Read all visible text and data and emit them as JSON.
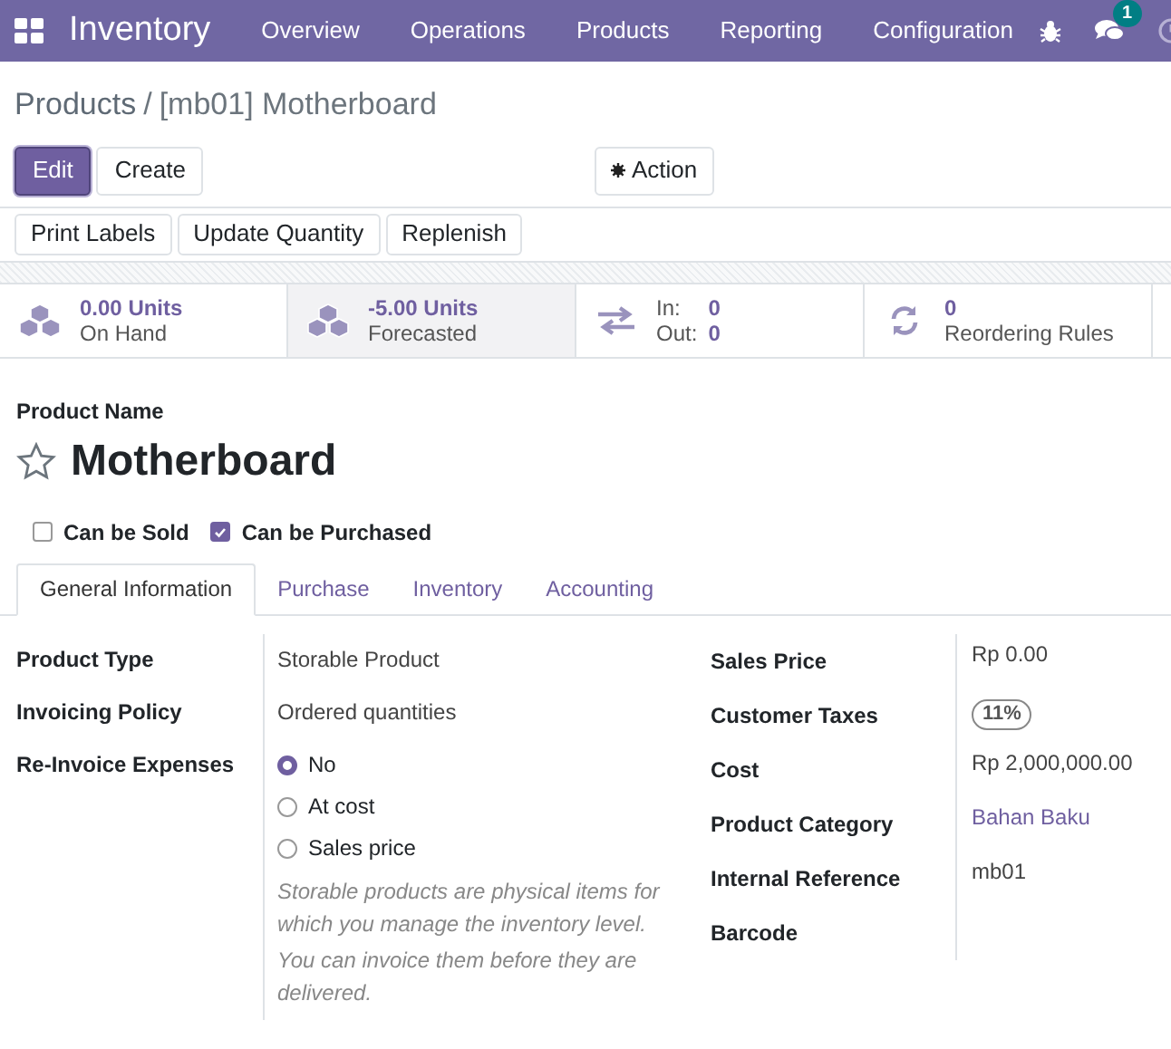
{
  "navbar": {
    "app_name": "Inventory",
    "menu": [
      "Overview",
      "Operations",
      "Products",
      "Reporting",
      "Configuration"
    ],
    "message_count": "1"
  },
  "breadcrumb": {
    "parent": "Products",
    "separator": "/",
    "current": "[mb01] Motherboard"
  },
  "buttons": [
    {
      "label": "Edit",
      "kind": "primary"
    },
    {
      "label": "Create",
      "kind": "secondary"
    }
  ],
  "action_button": "Action",
  "header_buttons": [
    "Print Labels",
    "Update Quantity",
    "Replenish"
  ],
  "stat_buttons": [
    {
      "kind": "stack",
      "value": "0.00 Units",
      "label": "On Hand",
      "selected": false
    },
    {
      "kind": "stack",
      "value": "-5.00 Units",
      "label": "Forecasted",
      "selected": true
    },
    {
      "kind": "inout",
      "in_label": "In:",
      "in_value": "0",
      "out_label": "Out:",
      "out_value": "0",
      "selected": false
    },
    {
      "kind": "refresh",
      "value": "0",
      "label": "Reordering Rules",
      "selected": false
    }
  ],
  "product_name_label": "Product Name",
  "product_name": "Motherboard",
  "favorite": false,
  "checkboxes": [
    {
      "label": "Can be Sold",
      "checked": false
    },
    {
      "label": "Can be Purchased",
      "checked": true
    }
  ],
  "tabs": [
    {
      "label": "General Information",
      "selected": true
    },
    {
      "label": "Purchase",
      "selected": false
    },
    {
      "label": "Inventory",
      "selected": false
    },
    {
      "label": "Accounting",
      "selected": false
    }
  ],
  "left_fields": [
    {
      "label": "Product Type",
      "kind": "text",
      "value": "Storable Product"
    },
    {
      "label": "Invoicing Policy",
      "kind": "text",
      "value": "Ordered quantities"
    },
    {
      "label": "Re-Invoice Expenses",
      "kind": "radio",
      "options": [
        {
          "label": "No",
          "selected": true
        },
        {
          "label": "At cost",
          "selected": false
        },
        {
          "label": "Sales price",
          "selected": false
        }
      ],
      "help": [
        "Storable products are physical items for which you manage the inventory level.",
        "You can invoice them before they are delivered."
      ]
    }
  ],
  "right_fields": [
    {
      "label": "Sales Price",
      "kind": "text",
      "value": "Rp 0.00"
    },
    {
      "label": "Customer Taxes",
      "kind": "tag",
      "value": "11%"
    },
    {
      "label": "Cost",
      "kind": "text",
      "value": "Rp 2,000,000.00"
    },
    {
      "label": "Product Category",
      "kind": "link",
      "value": "Bahan Baku"
    },
    {
      "label": "Internal Reference",
      "kind": "text",
      "value": "mb01"
    },
    {
      "label": "Barcode",
      "kind": "empty"
    }
  ]
}
